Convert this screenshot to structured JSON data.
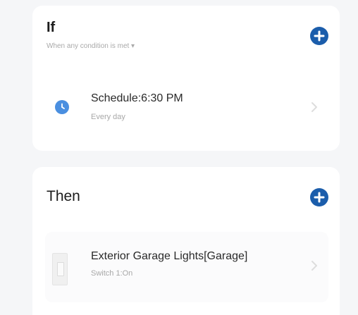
{
  "colors": {
    "accent": "#1b5dab",
    "clock_icon": "#4a8fe0",
    "background": "#f5f6f8",
    "card": "#ffffff"
  },
  "if_section": {
    "title": "If",
    "subtitle": "When any condition is met ▾",
    "add_icon": "plus-circle-icon",
    "condition": {
      "icon": "clock-icon",
      "title": "Schedule:6:30 PM",
      "subtitle": "Every day",
      "chevron_icon": "chevron-right-icon"
    }
  },
  "then_section": {
    "title": "Then",
    "add_icon": "plus-circle-icon",
    "action": {
      "icon": "wall-switch-icon",
      "title": "Exterior Garage Lights[Garage]",
      "subtitle": "Switch 1:On",
      "chevron_icon": "chevron-right-icon"
    }
  }
}
